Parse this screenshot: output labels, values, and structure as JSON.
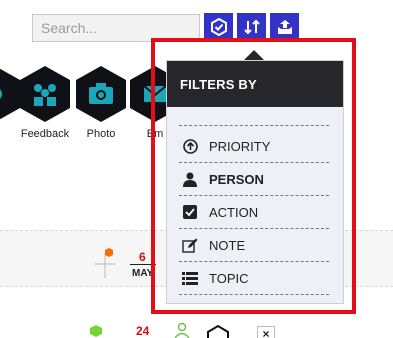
{
  "search": {
    "placeholder": "Search..."
  },
  "toolbar": {
    "buttons": [
      {
        "icon": "shield-check-icon"
      },
      {
        "icon": "sort-icon"
      },
      {
        "icon": "upload-box-icon"
      }
    ],
    "accent": "#3433c8"
  },
  "apps": [
    {
      "label": "",
      "icon": "partial-app-icon"
    },
    {
      "label": "Feedback",
      "icon": "feedback-icon"
    },
    {
      "label": "Photo",
      "icon": "camera-icon"
    },
    {
      "label": "Em",
      "icon": "email-icon"
    }
  ],
  "dropdown": {
    "header": "FILTERS BY",
    "items": [
      {
        "label": "PRIORITY",
        "icon": "arrow-up-circle-icon",
        "bold": false
      },
      {
        "label": "PERSON",
        "icon": "person-icon",
        "bold": true
      },
      {
        "label": "ACTION",
        "icon": "checkbox-icon",
        "bold": false
      },
      {
        "label": "NOTE",
        "icon": "edit-icon",
        "bold": false
      },
      {
        "label": "TOPIC",
        "icon": "list-icon",
        "bold": false
      }
    ]
  },
  "content": {
    "date_day": "6",
    "date_month": "MAY",
    "count": "24",
    "close_label": "×"
  },
  "colors": {
    "highlight": "#e30f16",
    "teal": "#1aa7b8",
    "date_red": "#d21010"
  }
}
